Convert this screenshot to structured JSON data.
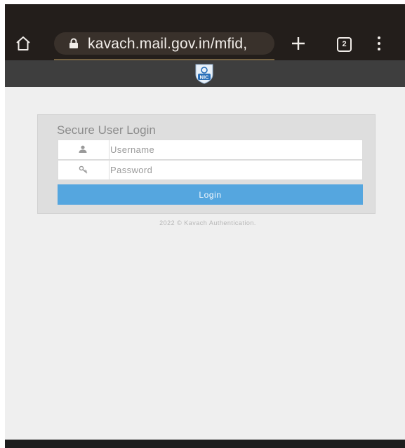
{
  "browser": {
    "url": "kavach.mail.gov.in/mfid,",
    "tab_count": "2",
    "icons": [
      "home-icon",
      "lock-icon",
      "plus-icon",
      "tab-count-icon",
      "more-vert-icon"
    ]
  },
  "header": {
    "logo_icon": "nic-shield-icon",
    "logo_text": "NIC"
  },
  "login": {
    "title": "Secure User Login",
    "username_placeholder": "Username",
    "password_placeholder": "Password",
    "username_icon": "user-icon",
    "password_icon": "key-icon",
    "submit_label": "Login"
  },
  "footer": {
    "text": "2022 © Kavach Authentication."
  },
  "colors": {
    "chrome_bg": "#231e1b",
    "header_bg": "#3e3e3e",
    "page_bg": "#efefef",
    "panel_bg": "#dedede",
    "button_bg": "#55a6df"
  }
}
